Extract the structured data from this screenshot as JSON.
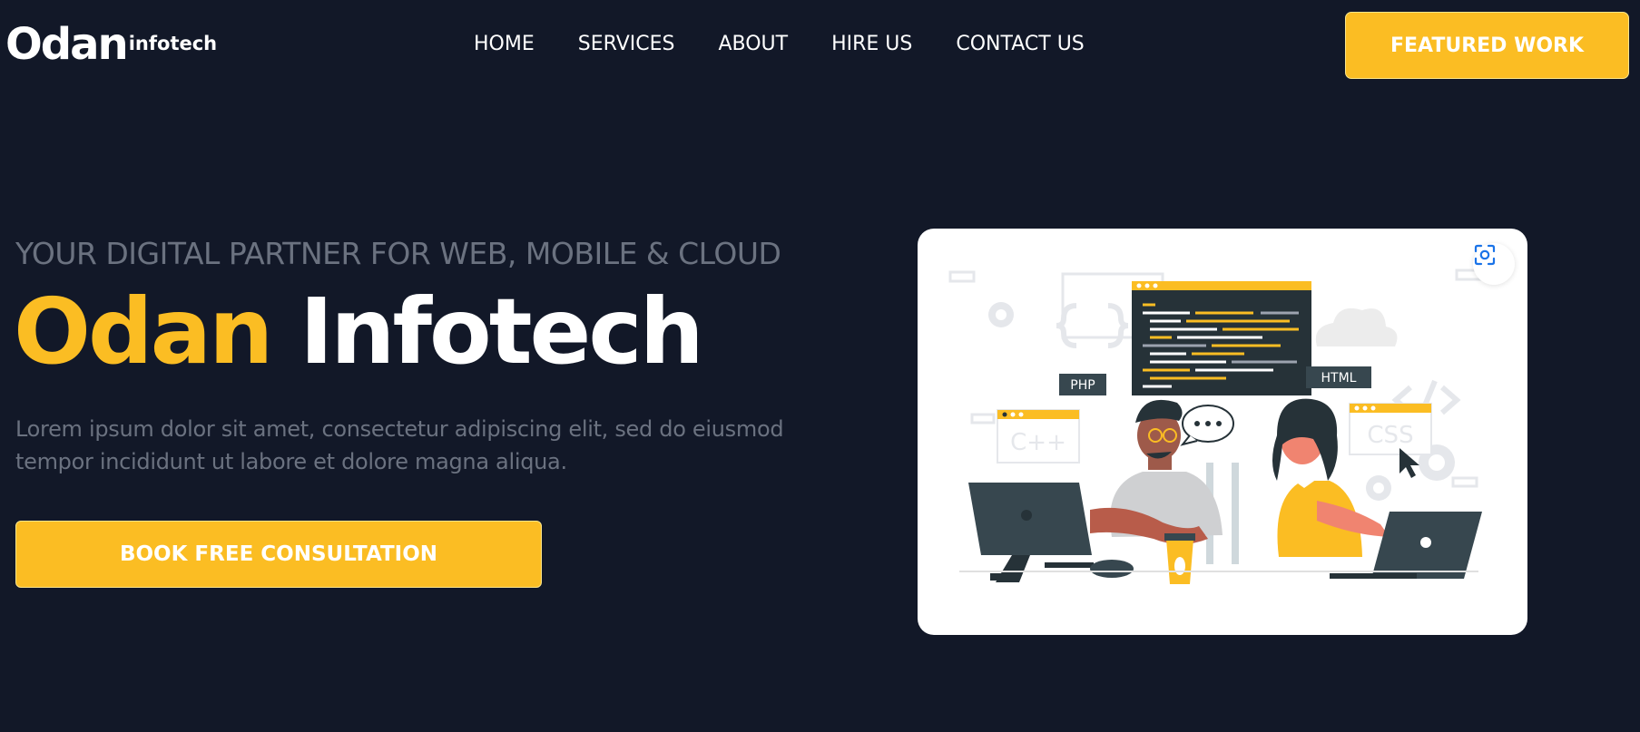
{
  "header": {
    "logo_main": "Odan",
    "logo_sub": "infotech",
    "nav": [
      "HOME",
      "SERVICES",
      "ABOUT",
      "HIRE US",
      "CONTACT US"
    ],
    "featured_label": "FEATURED WORK"
  },
  "hero": {
    "tagline": "YOUR DIGITAL PARTNER FOR WEB, MOBILE & CLOUD",
    "headline_yellow": "Odan",
    "headline_white": "Infotech",
    "description": "Lorem ipsum dolor sit amet, consectetur adipiscing elit, sed do eiusmod tempor incididunt ut labore et dolore magna aliqua.",
    "cta_label": "BOOK FREE CONSULTATION"
  },
  "illustration": {
    "tag_php": "PHP",
    "tag_html": "HTML",
    "tag_cpp": "C++",
    "tag_css": "CSS"
  },
  "colors": {
    "background": "#121828",
    "accent": "#fbbd23",
    "muted_text": "#6b7280"
  },
  "icons": {
    "lens": "visual-search-icon"
  }
}
